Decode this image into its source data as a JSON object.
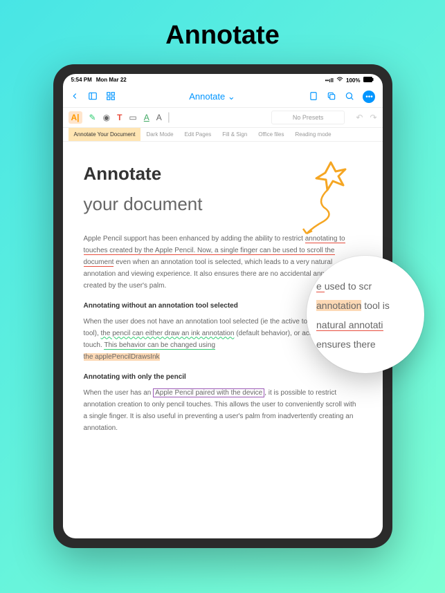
{
  "hero_title": "Annotate",
  "status": {
    "time": "5:54 PM",
    "date": "Mon Mar 22",
    "battery": "100%"
  },
  "nav": {
    "title": "Annotate",
    "chevron": "⌄"
  },
  "tools": {
    "presets": "No Presets"
  },
  "tabs": {
    "t0": "Annotate Your Document",
    "t1": "Dark Mode",
    "t2": "Edit Pages",
    "t3": "Fill & Sign",
    "t4": "Office files",
    "t5": "Reading mode"
  },
  "doc": {
    "title": "Annotate",
    "subtitle": "your document",
    "p1a": " Apple Pencil support has been enhanced by adding the ability to restrict ",
    "p1b": "annotating to touches created by the Apple Pencil. Now, a single finger can be used to scroll the document",
    "p1c": " even when an annotation tool is selected, which leads to a very natural annotation and viewing experience. It also ensures there are no accidental annotations created by the user's palm.",
    "h1": "Annotating without an annotation tool selected",
    "p2a": " When the user does not have an annotation tool selected (ie the active tool is the pan tool), ",
    "p2b": "the pencil can either draw an ink annotation",
    "p2c": " (default behavior), or act as a finger touch. ",
    "p2d": "This behavior can be changed using",
    "p2e": "the applePencilDrawsInk",
    "h2": "Annotating with only the pencil",
    "p3a": " When the user has an ",
    "p3b": "Apple Pencil paired with the device",
    "p3c": ", it is possible to restrict annotation creation to only pencil touches. This allows the user to conveniently scroll with a single finger. It is also useful in preventing a user's palm from inadvertently creating an annotation."
  },
  "mag": {
    "l1a": "e ",
    "l1b": "used to scr",
    "l2a": "annotation",
    "l2b": " tool is",
    "l3a": " ",
    "l3b": "natural annotati",
    "l4": "  ensures there"
  }
}
